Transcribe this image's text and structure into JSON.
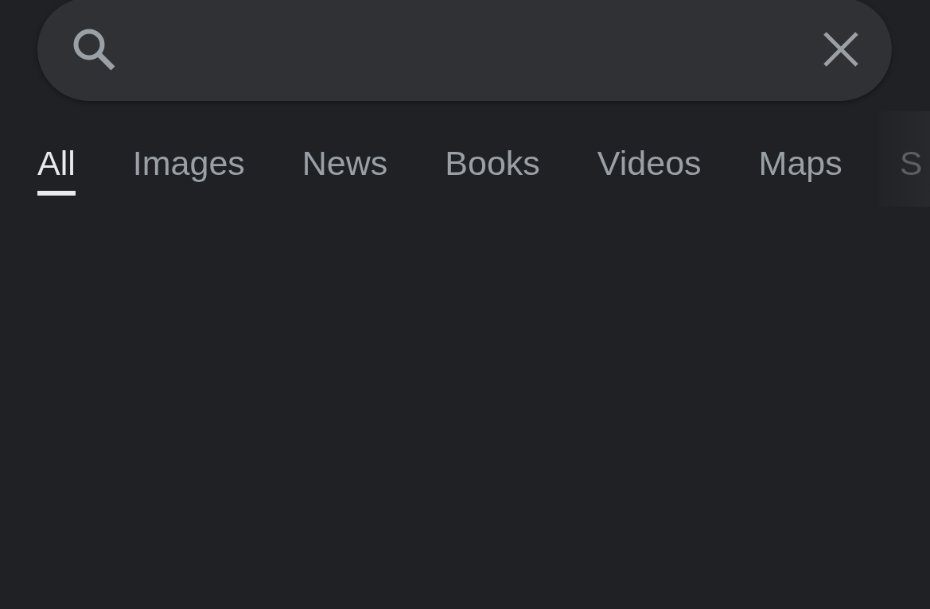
{
  "tabs": [
    {
      "label": "All",
      "selected": true,
      "dimmed": false
    },
    {
      "label": "Images",
      "selected": false,
      "dimmed": false
    },
    {
      "label": "News",
      "selected": false,
      "dimmed": false
    },
    {
      "label": "Books",
      "selected": false,
      "dimmed": false
    },
    {
      "label": "Videos",
      "selected": false,
      "dimmed": false
    },
    {
      "label": "Maps",
      "selected": false,
      "dimmed": false
    },
    {
      "label": "S",
      "selected": false,
      "dimmed": true
    }
  ]
}
